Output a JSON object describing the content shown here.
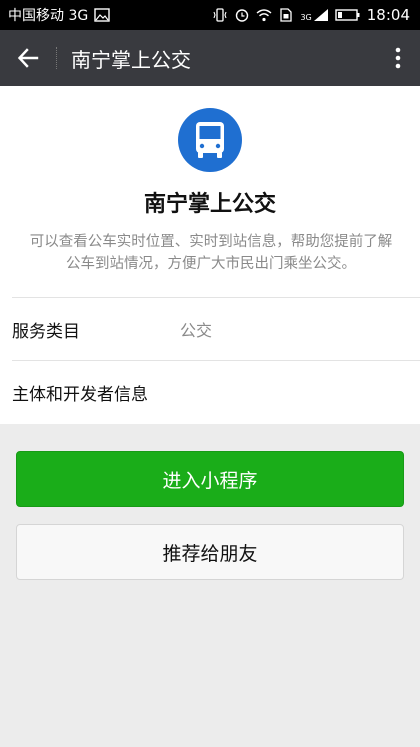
{
  "status_bar": {
    "carrier": "中国移动 3G",
    "network_badge": "3G",
    "time": "18:04",
    "icons": [
      "image-icon",
      "vibrate-icon",
      "alarm-icon",
      "wifi-icon",
      "sim-icon",
      "signal-icon",
      "battery-icon"
    ]
  },
  "app_bar": {
    "title": "南宁掌上公交",
    "back_icon": "back-arrow-icon",
    "more_icon": "more-vertical-icon"
  },
  "mini_program": {
    "logo_icon": "bus-icon",
    "name": "南宁掌上公交",
    "description": "可以查看公车实时位置、实时到站信息，帮助您提前了解公车到站情况，方便广大市民出门乘坐公交。"
  },
  "info_rows": [
    {
      "label": "服务类目",
      "value": "公交"
    },
    {
      "label": "主体和开发者信息",
      "value": ""
    }
  ],
  "actions": {
    "enter_label": "进入小程序",
    "share_label": "推荐给朋友"
  },
  "colors": {
    "status_bar_bg": "#000000",
    "app_bar_bg": "#393a3f",
    "logo_bg": "#1f6fd1",
    "primary_button": "#1aad19",
    "page_bg": "#ececec"
  }
}
